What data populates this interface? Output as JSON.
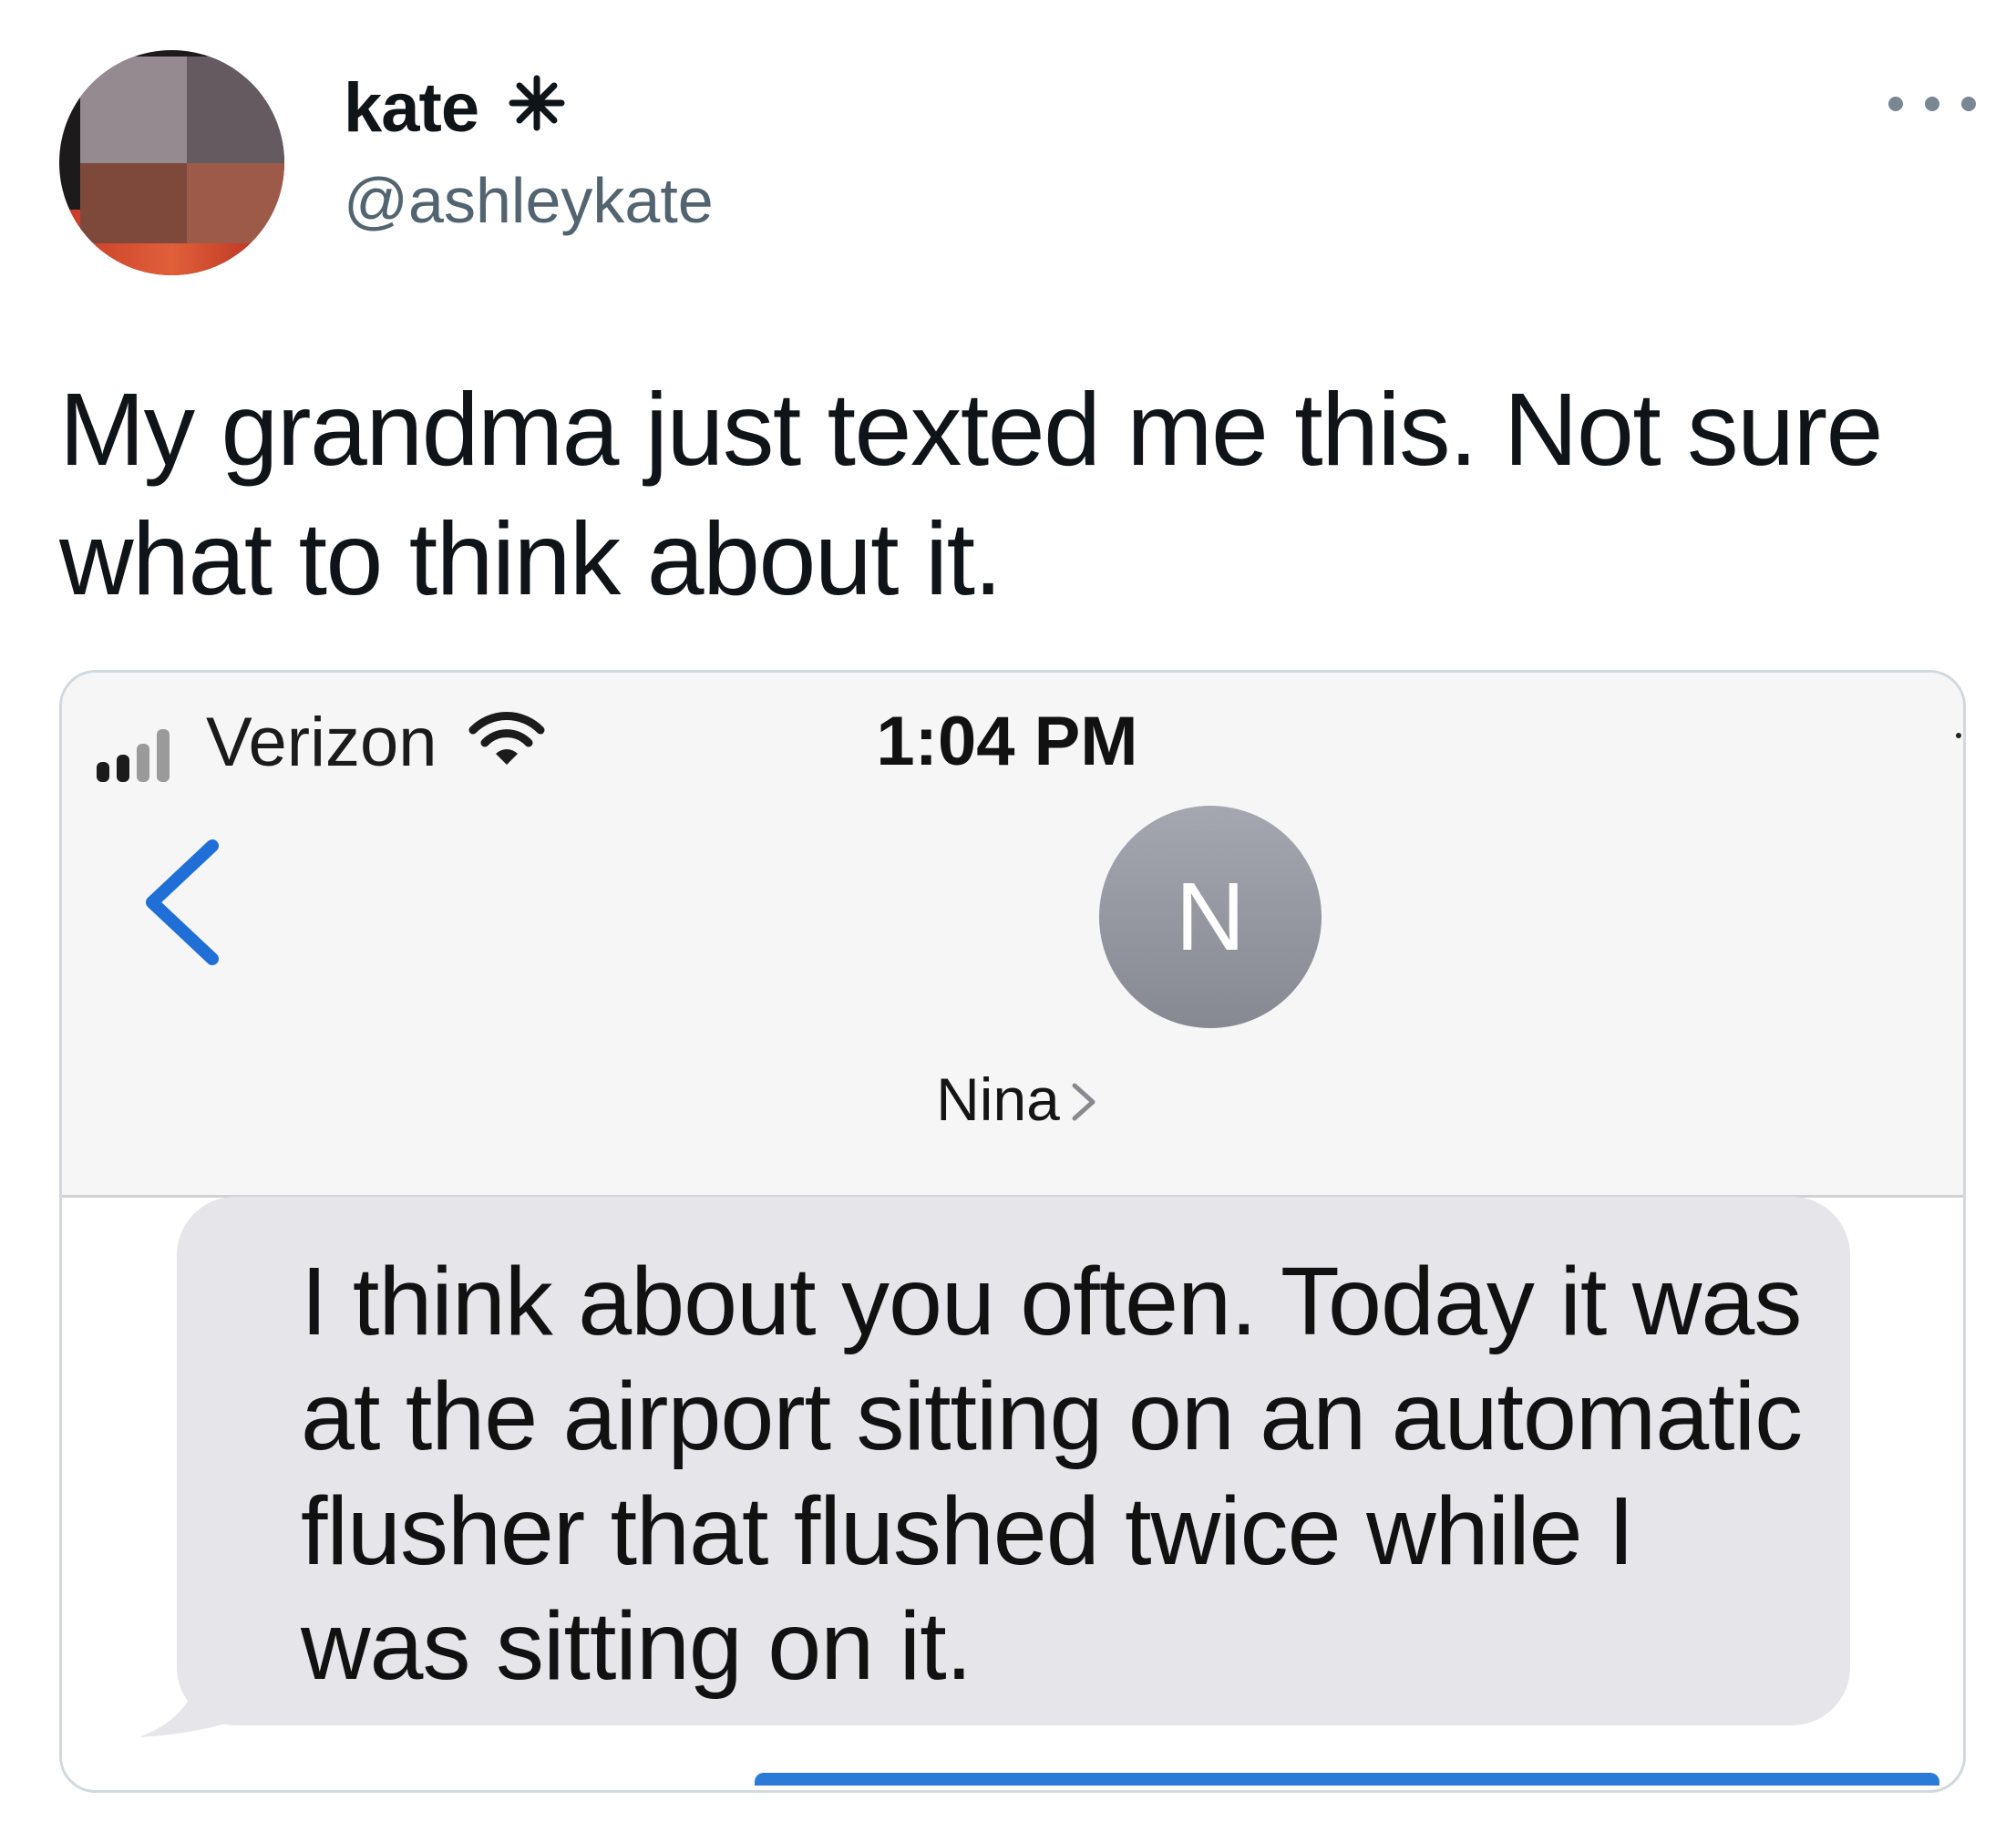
{
  "tweet": {
    "display_name": "kate",
    "handle": "@ashleykate",
    "text": "My grandma just texted me this. Not sure what to think about it."
  },
  "screenshot": {
    "carrier": "Verizon",
    "time": "1:04 PM",
    "contact_initial": "N",
    "contact_name": "Nina",
    "message": "I think about you often. Today it was at the airport sitting on an automatic flusher that flushed twice while I was sitting on it.",
    "accent_color": "#1f6fd6"
  },
  "icons": [
    "star-icon",
    "more-icon",
    "signal-icon",
    "wifi-icon",
    "back-chevron-icon",
    "chevron-right-icon"
  ]
}
